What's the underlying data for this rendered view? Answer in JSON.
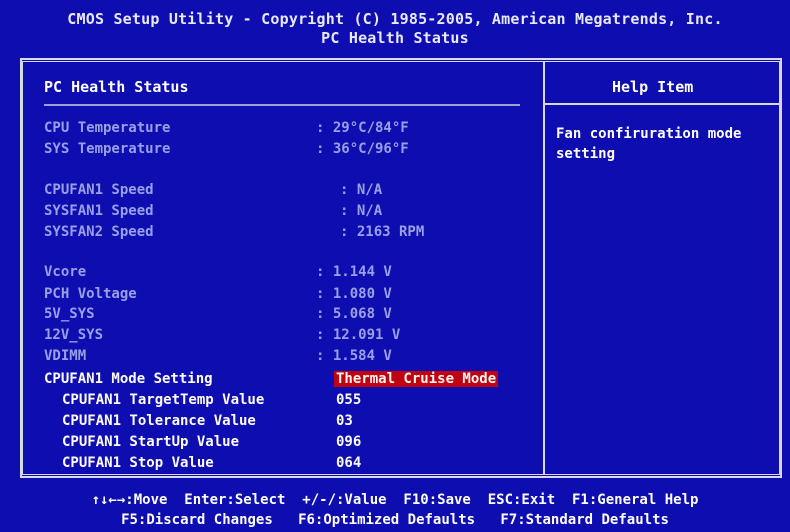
{
  "header": {
    "line1": "CMOS Setup Utility - Copyright (C) 1985-2005, American Megatrends, Inc.",
    "line2": "PC Health Status"
  },
  "panel": {
    "title": "PC Health Status",
    "help_title": "Help Item",
    "help_text": "Fan confiruration mode setting"
  },
  "temps": [
    {
      "label": "CPU Temperature",
      "value": ": 29°C/84°F"
    },
    {
      "label": "SYS Temperature",
      "value": ": 36°C/96°F"
    }
  ],
  "fans": [
    {
      "label": "CPUFAN1 Speed",
      "value": ": N/A"
    },
    {
      "label": "SYSFAN1 Speed",
      "value": ": N/A"
    },
    {
      "label": "SYSFAN2 Speed",
      "value": ": 2163 RPM"
    }
  ],
  "voltages": [
    {
      "label": "Vcore",
      "value": ": 1.144 V"
    },
    {
      "label": "PCH Voltage",
      "value": ": 1.080 V"
    },
    {
      "label": "5V_SYS",
      "value": ": 5.068 V"
    },
    {
      "label": "12V_SYS",
      "value": ": 12.091 V"
    },
    {
      "label": "VDIMM",
      "value": ": 1.584 V"
    }
  ],
  "mode_setting": {
    "label": "CPUFAN1 Mode Setting",
    "value": "Thermal Cruise Mode"
  },
  "sub_settings": [
    {
      "label": "CPUFAN1 TargetTemp Value",
      "value": "055"
    },
    {
      "label": "CPUFAN1 Tolerance Value",
      "value": "03"
    },
    {
      "label": "CPUFAN1 StartUp Value",
      "value": "096"
    },
    {
      "label": "CPUFAN1 Stop Value",
      "value": "064"
    }
  ],
  "footer": {
    "line1": "↑↓←→:Move  Enter:Select  +/-/:Value  F10:Save  ESC:Exit  F1:General Help",
    "line2": "F5:Discard Changes   F6:Optimized Defaults   F7:Standard Defaults"
  },
  "colors": {
    "background": "#0d0db0",
    "selected_bg": "#c00010",
    "dim_text": "#9aa0e8"
  }
}
